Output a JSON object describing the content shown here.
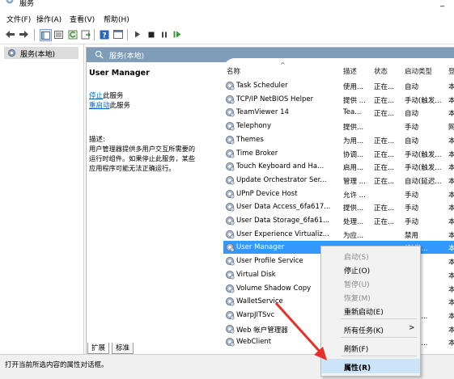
{
  "window": {
    "title": "服务",
    "minimize_glyph": "_"
  },
  "menu": [
    {
      "label": "文件(F)",
      "name": "menu-file"
    },
    {
      "label": "操作(A)",
      "name": "menu-action"
    },
    {
      "label": "查看(V)",
      "name": "menu-view"
    },
    {
      "label": "帮助(H)",
      "name": "menu-help"
    }
  ],
  "tree": {
    "root_label": "服务(本地)"
  },
  "panel": {
    "header": "服务(本地)"
  },
  "detail": {
    "service_name": "User Manager",
    "stop_link": "停止",
    "stop_suffix": "此服务",
    "restart_link": "重启动",
    "restart_suffix": "此服务",
    "desc_label": "描述:",
    "desc_lines": [
      "用户管理器提供多用户交互所需要的",
      "运行时组件。如果停止此服务，某些",
      "应用程序可能无法正确运行。"
    ]
  },
  "columns": {
    "name": "名称",
    "desc": "描述",
    "status": "状态",
    "startup": "启动类型",
    "logon": "登"
  },
  "rows": [
    {
      "name": "Task Scheduler",
      "desc": "使用...",
      "status": "正在...",
      "startup": "自动",
      "logon": "本"
    },
    {
      "name": "TCP/IP NetBIOS Helper",
      "desc": "提供 ...",
      "status": "正在...",
      "startup": "手动(触发...",
      "logon": "本"
    },
    {
      "name": "TeamViewer 14",
      "desc": "Tea...",
      "status": "正在...",
      "startup": "自动",
      "logon": "本"
    },
    {
      "name": "Telephony",
      "desc": "提供...",
      "status": "",
      "startup": "手动",
      "logon": "网"
    },
    {
      "name": "Themes",
      "desc": "为用...",
      "status": "正在...",
      "startup": "自动",
      "logon": "本"
    },
    {
      "name": "Time Broker",
      "desc": "协调...",
      "status": "正在...",
      "startup": "手动(触发...",
      "logon": "本"
    },
    {
      "name": "Touch Keyboard and Ha...",
      "desc": "启用...",
      "status": "正在...",
      "startup": "手动(触发...",
      "logon": "本"
    },
    {
      "name": "Update Orchestrator Ser...",
      "desc": "管理 ...",
      "status": "正在...",
      "startup": "自动(延迟...",
      "logon": "本"
    },
    {
      "name": "UPnP Device Host",
      "desc": "允许 ...",
      "status": "",
      "startup": "手动",
      "logon": "本"
    },
    {
      "name": "User Data Access_6fa617...",
      "desc": "提供...",
      "status": "正在...",
      "startup": "手动",
      "logon": "本"
    },
    {
      "name": "User Data Storage_6fa61...",
      "desc": "处理...",
      "status": "正在...",
      "startup": "手动",
      "logon": "本"
    },
    {
      "name": "User Experience Virtualiz...",
      "desc": "为应...",
      "status": "",
      "startup": "禁用",
      "logon": "本"
    },
    {
      "name": "User Manager",
      "desc": "",
      "status": "",
      "startup": "(触发...",
      "logon": "本"
    },
    {
      "name": "User Profile Service",
      "desc": "",
      "status": "",
      "startup": "",
      "logon": "本"
    },
    {
      "name": "Virtual Disk",
      "desc": "",
      "status": "",
      "startup": "",
      "logon": "本"
    },
    {
      "name": "Volume Shadow Copy",
      "desc": "",
      "status": "",
      "startup": "",
      "logon": "本"
    },
    {
      "name": "WalletService",
      "desc": "",
      "status": "",
      "startup": "",
      "logon": "本"
    },
    {
      "name": "WarpJITSvc",
      "desc": "",
      "status": "",
      "startup": "(触发...",
      "logon": "本"
    },
    {
      "name": "Web 帐户管理器",
      "desc": "",
      "status": "",
      "startup": "",
      "logon": "本"
    },
    {
      "name": "WebClient",
      "desc": "",
      "status": "",
      "startup": "(触发...",
      "logon": "本"
    }
  ],
  "context_menu": {
    "start": "启动(S)",
    "stop": "停止(O)",
    "pause": "暂停(U)",
    "resume": "恢复(M)",
    "restart": "重新启动(E)",
    "all_tasks": "所有任务(K)",
    "refresh": "刷新(F)",
    "properties": "属性(R)",
    "submenu_glyph": ">"
  },
  "tabs": {
    "extended": "扩展",
    "standard": "标准"
  },
  "status_bar": {
    "text": "打开当前所选内容的属性对话框。"
  },
  "colors": {
    "selection": "#3399ff",
    "header": "#7f9db9",
    "link": "#0066cc",
    "arrow": "#e8302a",
    "menu_highlight": "#cce4f7"
  },
  "icons": {
    "gear": "gear-icon",
    "back": "back-arrow-icon",
    "forward": "forward-arrow-icon",
    "play": "play-icon",
    "stop": "stop-icon",
    "pause": "pause-icon",
    "restart": "restart-icon"
  }
}
